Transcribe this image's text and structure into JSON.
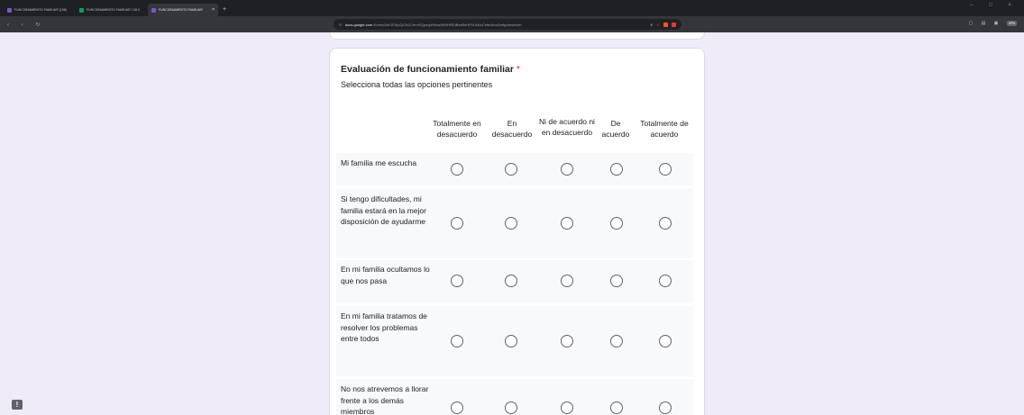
{
  "browser": {
    "tabs": [
      {
        "label": "FUNCIONAMIENTO FAMILIAR (198)",
        "color": "#7e57c2",
        "active": false
      },
      {
        "label": "FUNCIONAMIENTO FAMILIAR I 1B 0",
        "color": "#0f9d58",
        "active": false
      },
      {
        "label": "FUNCIONAMIENTO FAMILIAR",
        "color": "#7e57c2",
        "active": true
      }
    ],
    "new_tab_label": "+",
    "url_host": "docs.google.com",
    "url_path": "/forms/d/e/1FAIpQLScZ-fxmHQpnxjdHkazWtHHBDIBzsBehFHUsNuCetbrNnoAmfg/viewform",
    "vpn_label": "VPN"
  },
  "form": {
    "question_title": "Evaluación de funcionamiento familiar",
    "required_marker": "*",
    "description": "Selecciona todas las opciones pertinentes",
    "columns": [
      "Totalmente en desacuerdo",
      "En desacuerdo",
      "Ni de acuerdo ni en desacuerdo",
      "De acuerdo",
      "Totalmente de acuerdo"
    ],
    "rows": [
      "Mi familia me escucha",
      "Si tengo dificultades, mi familia estará en la mejor disposición de ayudarme",
      "En mi familia ocultamos lo que nos pasa",
      "En mi familia tratamos de resolver los problemas entre todos",
      "No nos atrevemos a llorar frente a los demás miembros"
    ]
  },
  "colors": {
    "page_background": "#f0ebf8",
    "required": "#d93025",
    "radio_border": "#5f6368"
  },
  "feedback_label": "!"
}
